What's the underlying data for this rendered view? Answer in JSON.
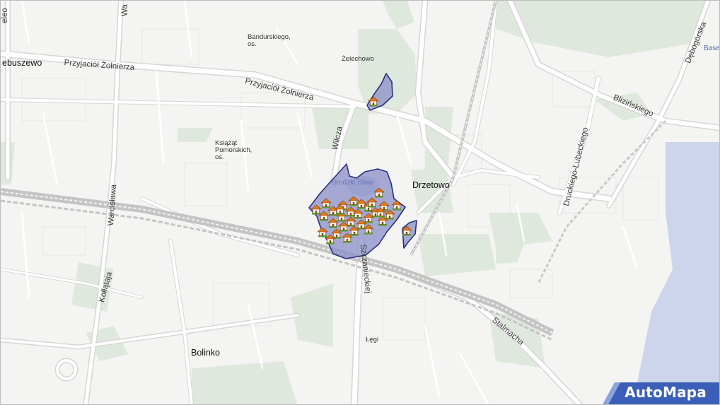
{
  "brand": {
    "name": "AutoMapa"
  },
  "map": {
    "colors": {
      "background": "#f4f4f2",
      "street": "#ffffff",
      "street_casing": "#d6d6d4",
      "green": "#dfe8dc",
      "water": "#ccd5ec",
      "rail": "#b6b6b6",
      "highlight_fill": "#8a8fc7",
      "highlight_stroke": "#2b3080"
    },
    "districts": {
      "bandurskiego": "Bandurskiego,",
      "bandurskiego_os": "os.",
      "zelechowo": "Żelechowo",
      "ksiazat": "Książąt",
      "pomorskich": "Pomorskich,",
      "pomorskich_os": "os.",
      "drzetowo": "Drzetowo",
      "bolinko": "Bolinko",
      "legi": "Łęgi",
      "glebokie_partial": "ebuszewo",
      "brodzki_staw": "Brodzki Staw",
      "base_partial": "Base"
    },
    "streets": {
      "przyjaciol_1": "Przyjaciół Żołnierza",
      "przyjaciol_2": "Przyjaciół Żołnierza",
      "wilcza": "Wilcza",
      "warcislawa": "Warcisława",
      "kollataja": "Kołłątaja",
      "szczanieckiej": "Szczanieckiej",
      "stalmacha": "Stalmacha",
      "druckiego": "Druckiego-Lubeckiego",
      "blizinskiego": "Blizińskiego",
      "debogorska": "Dębogórska",
      "wa_partial": "Wa",
      "edge_left_partial": "eleo"
    },
    "markers": {
      "icon": "house-icon",
      "count": 33
    }
  }
}
